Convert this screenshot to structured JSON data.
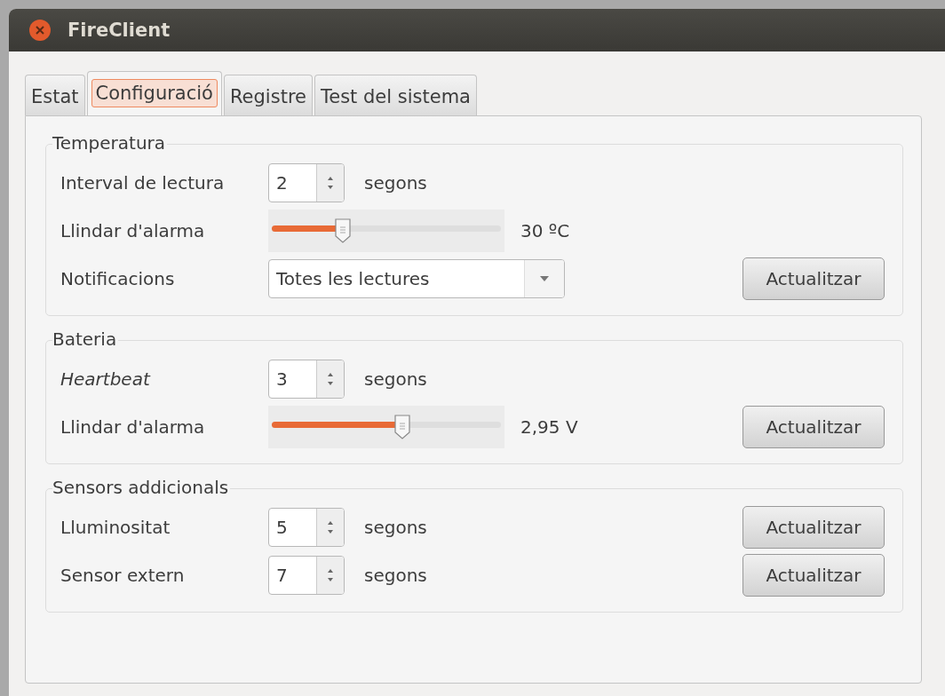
{
  "window": {
    "title": "FireClient"
  },
  "tabs": [
    {
      "label": "Estat",
      "selected": false
    },
    {
      "label": "Configuració",
      "selected": true
    },
    {
      "label": "Registre",
      "selected": false
    },
    {
      "label": "Test del sistema",
      "selected": false
    }
  ],
  "groups": [
    {
      "title": "Temperatura",
      "rows": [
        {
          "kind": "spin",
          "label": "Interval de lectura",
          "value": "2",
          "unit": "segons"
        },
        {
          "kind": "slider",
          "label": "Llindar d'alarma",
          "level": 0.31,
          "reading": "30 ºC"
        },
        {
          "kind": "combo",
          "label": "Notificacions",
          "value": "Totes les lectures",
          "button": "Actualitzar"
        }
      ]
    },
    {
      "title": "Bateria",
      "rows": [
        {
          "kind": "spin",
          "label": "Heartbeat",
          "italic": true,
          "value": "3",
          "unit": "segons"
        },
        {
          "kind": "slider",
          "label": "Llindar d'alarma",
          "level": 0.57,
          "reading": "2,95 V",
          "button": "Actualitzar"
        }
      ]
    },
    {
      "title": "Sensors addicionals",
      "rows": [
        {
          "kind": "spin",
          "label": "Lluminositat",
          "value": "5",
          "unit": "segons",
          "button": "Actualitzar"
        },
        {
          "kind": "spin",
          "label": "Sensor extern",
          "value": "7",
          "unit": "segons",
          "button": "Actualitzar"
        }
      ]
    }
  ]
}
